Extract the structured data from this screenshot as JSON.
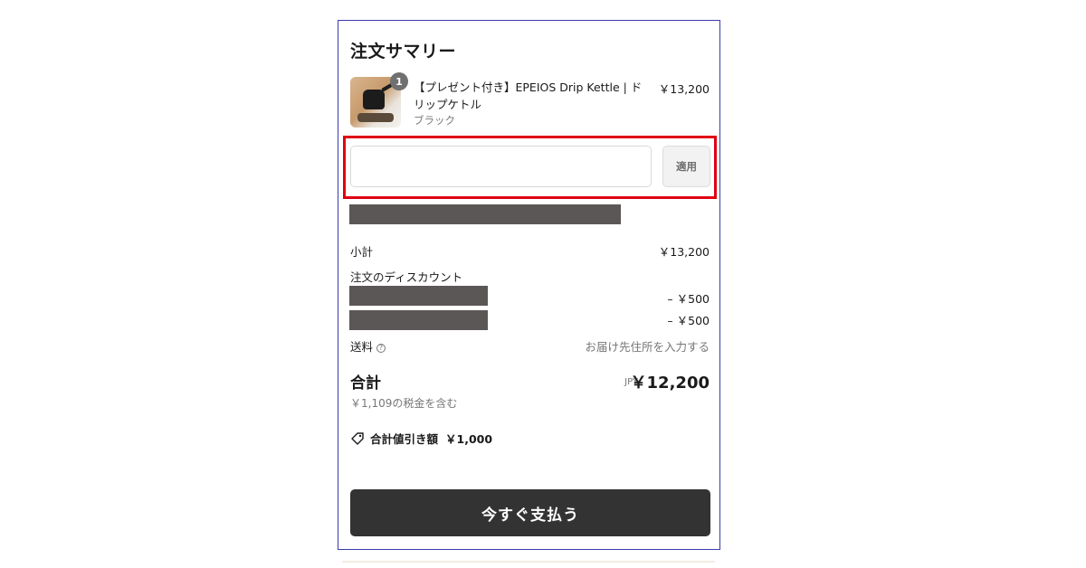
{
  "summary": {
    "title": "注文サマリー"
  },
  "item": {
    "quantity": "1",
    "name": "【プレゼント付き】EPEIOS Drip Kettle | ドリップケトル",
    "variant": "ブラック",
    "price": "￥13,200"
  },
  "discount": {
    "input_value": "",
    "apply_label": "適用"
  },
  "totals": {
    "subtotal_label": "小計",
    "subtotal_value": "￥13,200",
    "order_discount_label": "注文のディスカウント",
    "discount_1_value": "– ￥500",
    "discount_2_value": "– ￥500",
    "shipping_label": "送料",
    "shipping_value": "お届け先住所を入力する",
    "total_label": "合計",
    "currency": "JPY",
    "total_value": "￥12,200",
    "tax_note": "￥1,109の税金を含む",
    "savings_label": "合計値引き額",
    "savings_value": "￥1,000"
  },
  "actions": {
    "pay_label": "今すぐ支払う"
  },
  "colors": {
    "highlight": "#e00012",
    "button": "#333333",
    "redaction": "#5c5757"
  }
}
